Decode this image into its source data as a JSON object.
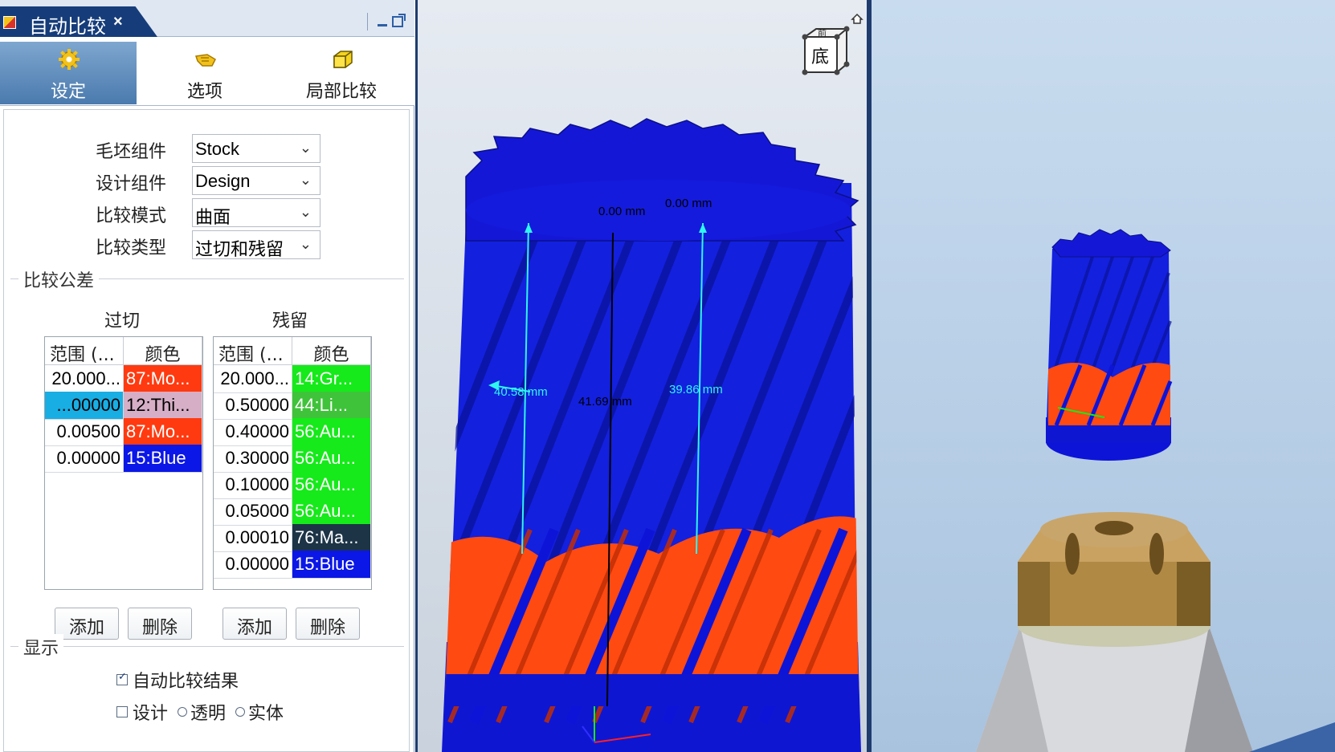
{
  "window": {
    "title": "自动比较",
    "close_label": "×"
  },
  "tabs": [
    {
      "label": "设定",
      "icon": "gear-icon",
      "active": true
    },
    {
      "label": "选项",
      "icon": "pointer-hand-icon",
      "active": false
    },
    {
      "label": "局部比较",
      "icon": "cube-icon",
      "active": false
    }
  ],
  "fields": [
    {
      "label": "毛坯组件",
      "value": "Stock"
    },
    {
      "label": "设计组件",
      "value": "Design"
    },
    {
      "label": "比较模式",
      "value": "曲面"
    },
    {
      "label": "比较类型",
      "value": "过切和残留"
    }
  ],
  "tolerance": {
    "group_title": "比较公差",
    "overcut": {
      "title": "过切",
      "headers": [
        "范围 (...",
        "颜色"
      ],
      "rows": [
        {
          "range": "20.000...",
          "color": "87:Mo...",
          "hex": "#ff3a10"
        },
        {
          "range": "...00000",
          "color": "12:Thi...",
          "hex": "#d6aec6",
          "selected": true
        },
        {
          "range": "0.00500",
          "color": "87:Mo...",
          "hex": "#ff3a10"
        },
        {
          "range": "0.00000",
          "color": "15:Blue",
          "hex": "#0b17e6"
        }
      ],
      "add_label": "添加",
      "delete_label": "删除"
    },
    "residual": {
      "title": "残留",
      "headers": [
        "范围 (...",
        "颜色"
      ],
      "rows": [
        {
          "range": "20.000...",
          "color": "14:Gr...",
          "hex": "#16ea1a"
        },
        {
          "range": "0.50000",
          "color": "44:Li...",
          "hex": "#3fc33a"
        },
        {
          "range": "0.40000",
          "color": "56:Au...",
          "hex": "#16ea1a"
        },
        {
          "range": "0.30000",
          "color": "56:Au...",
          "hex": "#16ea1a"
        },
        {
          "range": "0.10000",
          "color": "56:Au...",
          "hex": "#16ea1a"
        },
        {
          "range": "0.05000",
          "color": "56:Au...",
          "hex": "#16ea1a"
        },
        {
          "range": "0.00010",
          "color": "76:Ma...",
          "hex": "#1c3446"
        },
        {
          "range": "0.00000",
          "color": "15:Blue",
          "hex": "#0b17e6"
        }
      ],
      "add_label": "添加",
      "delete_label": "删除"
    }
  },
  "display": {
    "group_title": "显示",
    "auto_compare_label": "自动比较结果",
    "auto_compare_checked": true,
    "row2": [
      "设计",
      "透明",
      "实体"
    ]
  },
  "viewport": {
    "view_cube_top": "前",
    "view_cube_face": "底",
    "dims": {
      "left": "40.58 mm",
      "center": "41.69 mm",
      "right": "39.86 mm",
      "top1": "0.00 mm",
      "top2": "0.00 mm"
    }
  },
  "colors": {
    "accent_dark": "#163d7a",
    "tab_active": "#5b89bb",
    "mesh_blue": "#0d14d8",
    "gouge_orange": "#ff4a12"
  }
}
